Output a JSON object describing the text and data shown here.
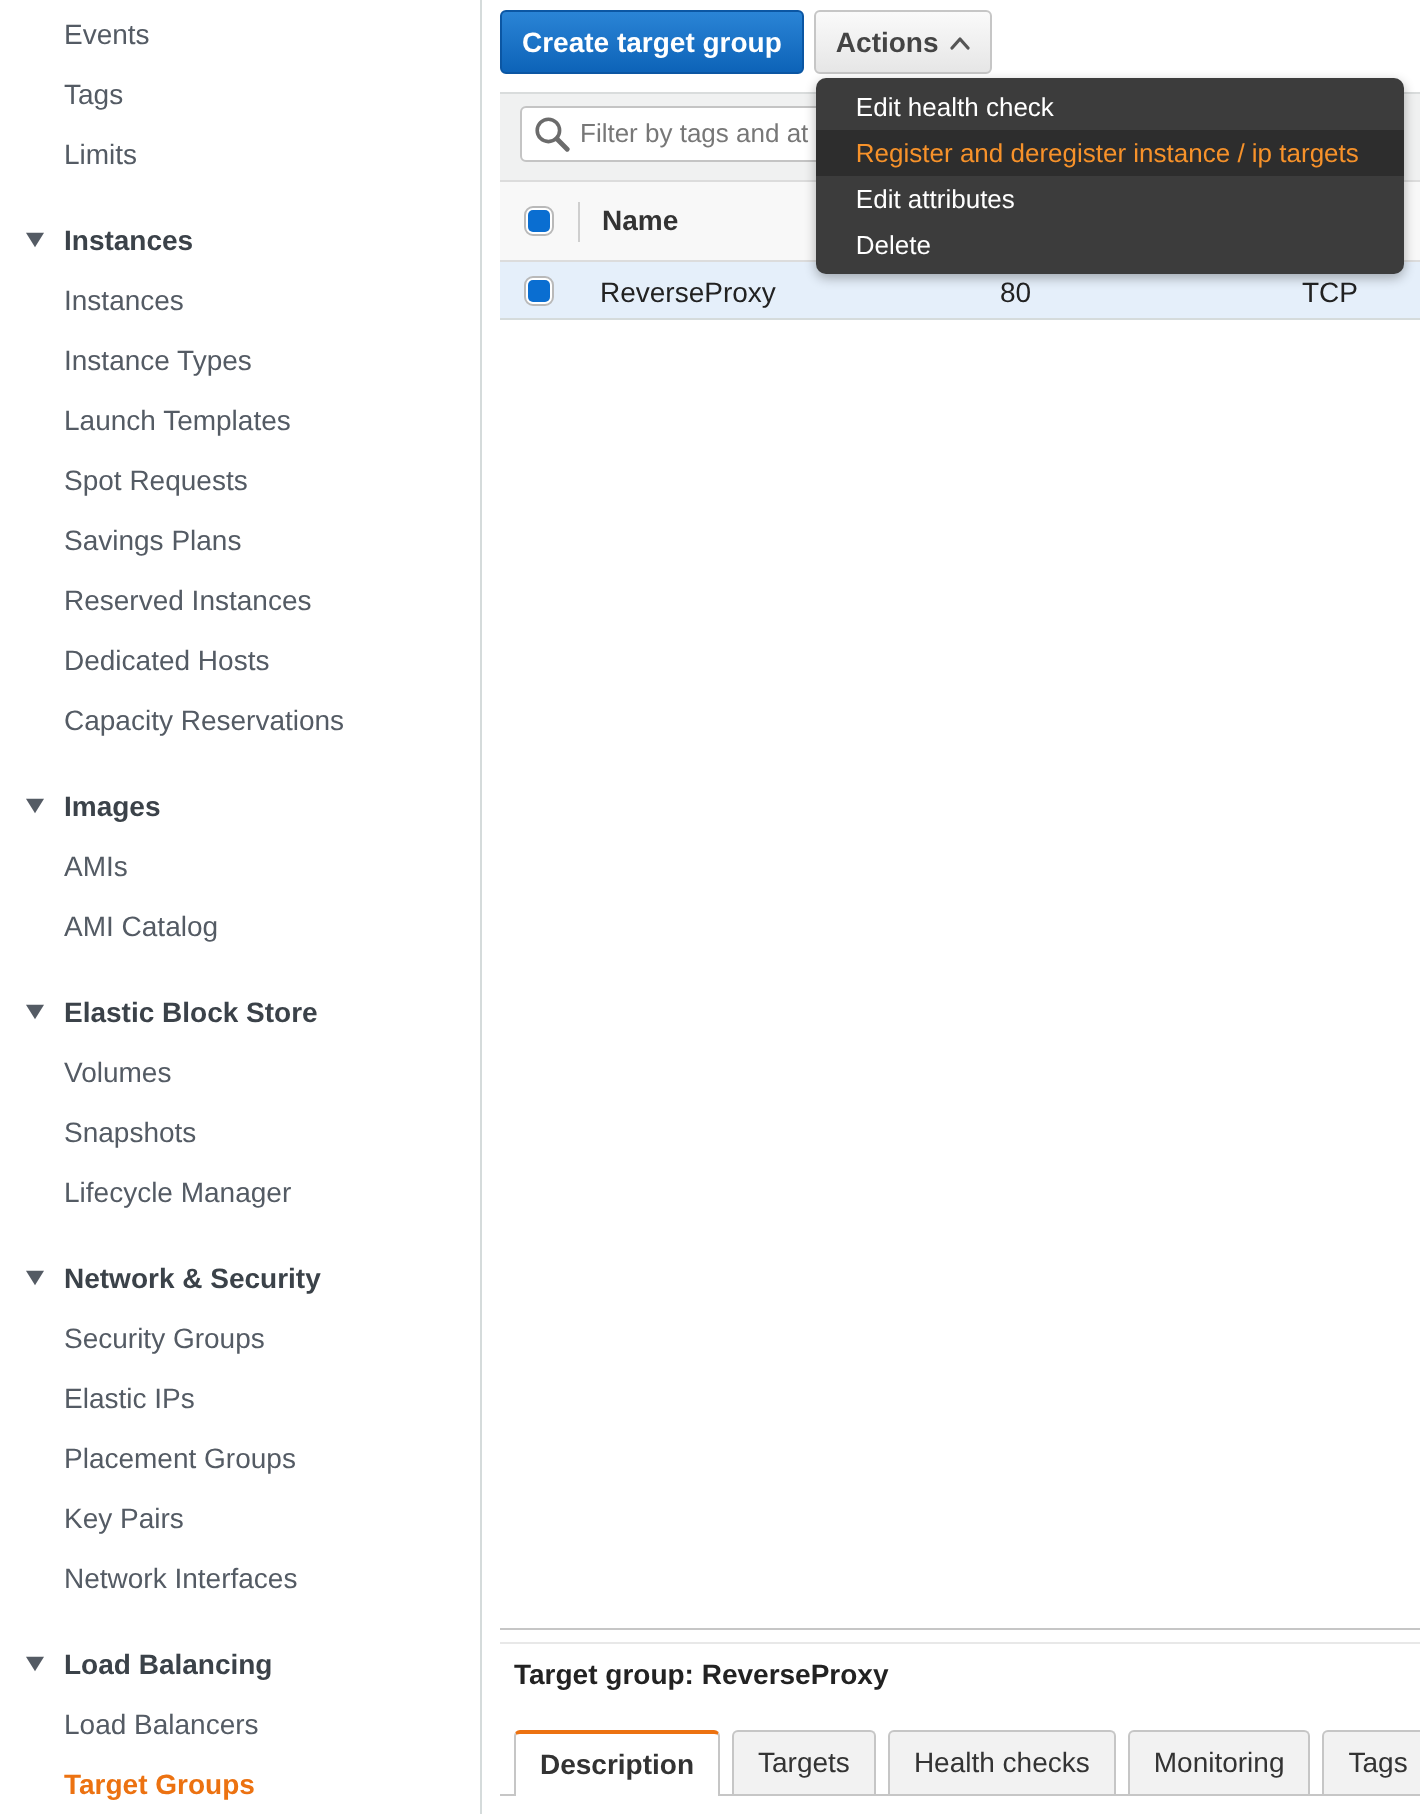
{
  "sidebar": {
    "sections": [
      {
        "items": [
          {
            "label": "Events",
            "selected": false
          },
          {
            "label": "Tags",
            "selected": false
          },
          {
            "label": "Limits",
            "selected": false
          }
        ]
      },
      {
        "title": "Instances",
        "expanded": true,
        "items": [
          {
            "label": "Instances",
            "selected": false
          },
          {
            "label": "Instance Types",
            "selected": false
          },
          {
            "label": "Launch Templates",
            "selected": false
          },
          {
            "label": "Spot Requests",
            "selected": false
          },
          {
            "label": "Savings Plans",
            "selected": false
          },
          {
            "label": "Reserved Instances",
            "selected": false
          },
          {
            "label": "Dedicated Hosts",
            "selected": false
          },
          {
            "label": "Capacity Reservations",
            "selected": false
          }
        ]
      },
      {
        "title": "Images",
        "expanded": true,
        "items": [
          {
            "label": "AMIs",
            "selected": false
          },
          {
            "label": "AMI Catalog",
            "selected": false
          }
        ]
      },
      {
        "title": "Elastic Block Store",
        "expanded": true,
        "items": [
          {
            "label": "Volumes",
            "selected": false
          },
          {
            "label": "Snapshots",
            "selected": false
          },
          {
            "label": "Lifecycle Manager",
            "selected": false
          }
        ]
      },
      {
        "title": "Network & Security",
        "expanded": true,
        "items": [
          {
            "label": "Security Groups",
            "selected": false
          },
          {
            "label": "Elastic IPs",
            "selected": false
          },
          {
            "label": "Placement Groups",
            "selected": false
          },
          {
            "label": "Key Pairs",
            "selected": false
          },
          {
            "label": "Network Interfaces",
            "selected": false
          }
        ]
      },
      {
        "title": "Load Balancing",
        "expanded": true,
        "items": [
          {
            "label": "Load Balancers",
            "selected": false
          },
          {
            "label": "Target Groups",
            "selected": true
          }
        ]
      }
    ]
  },
  "toolbar": {
    "buttons": [
      {
        "kind": "primary",
        "label": "Create target group"
      },
      {
        "kind": "menu",
        "label": "Actions",
        "expanded": true,
        "menu": [
          {
            "label": "Edit health check",
            "highlighted": false
          },
          {
            "label": "Register and deregister instance / ip targets",
            "highlighted": true
          },
          {
            "label": "Edit attributes",
            "highlighted": false
          },
          {
            "label": "Delete",
            "highlighted": false
          }
        ]
      }
    ]
  },
  "filter": {
    "placeholder": "Filter by tags and at"
  },
  "table": {
    "select_all_checked": true,
    "columns": [
      "Name"
    ],
    "rows": [
      {
        "selected": true,
        "checked": true,
        "cells": [
          "ReverseProxy",
          "80",
          "TCP"
        ]
      }
    ]
  },
  "details": {
    "title": "Target group: ReverseProxy",
    "tabs": [
      {
        "label": "Description",
        "selected": true
      },
      {
        "label": "Targets",
        "selected": false
      },
      {
        "label": "Health checks",
        "selected": false
      },
      {
        "label": "Monitoring",
        "selected": false
      },
      {
        "label": "Tags",
        "selected": false
      }
    ]
  }
}
